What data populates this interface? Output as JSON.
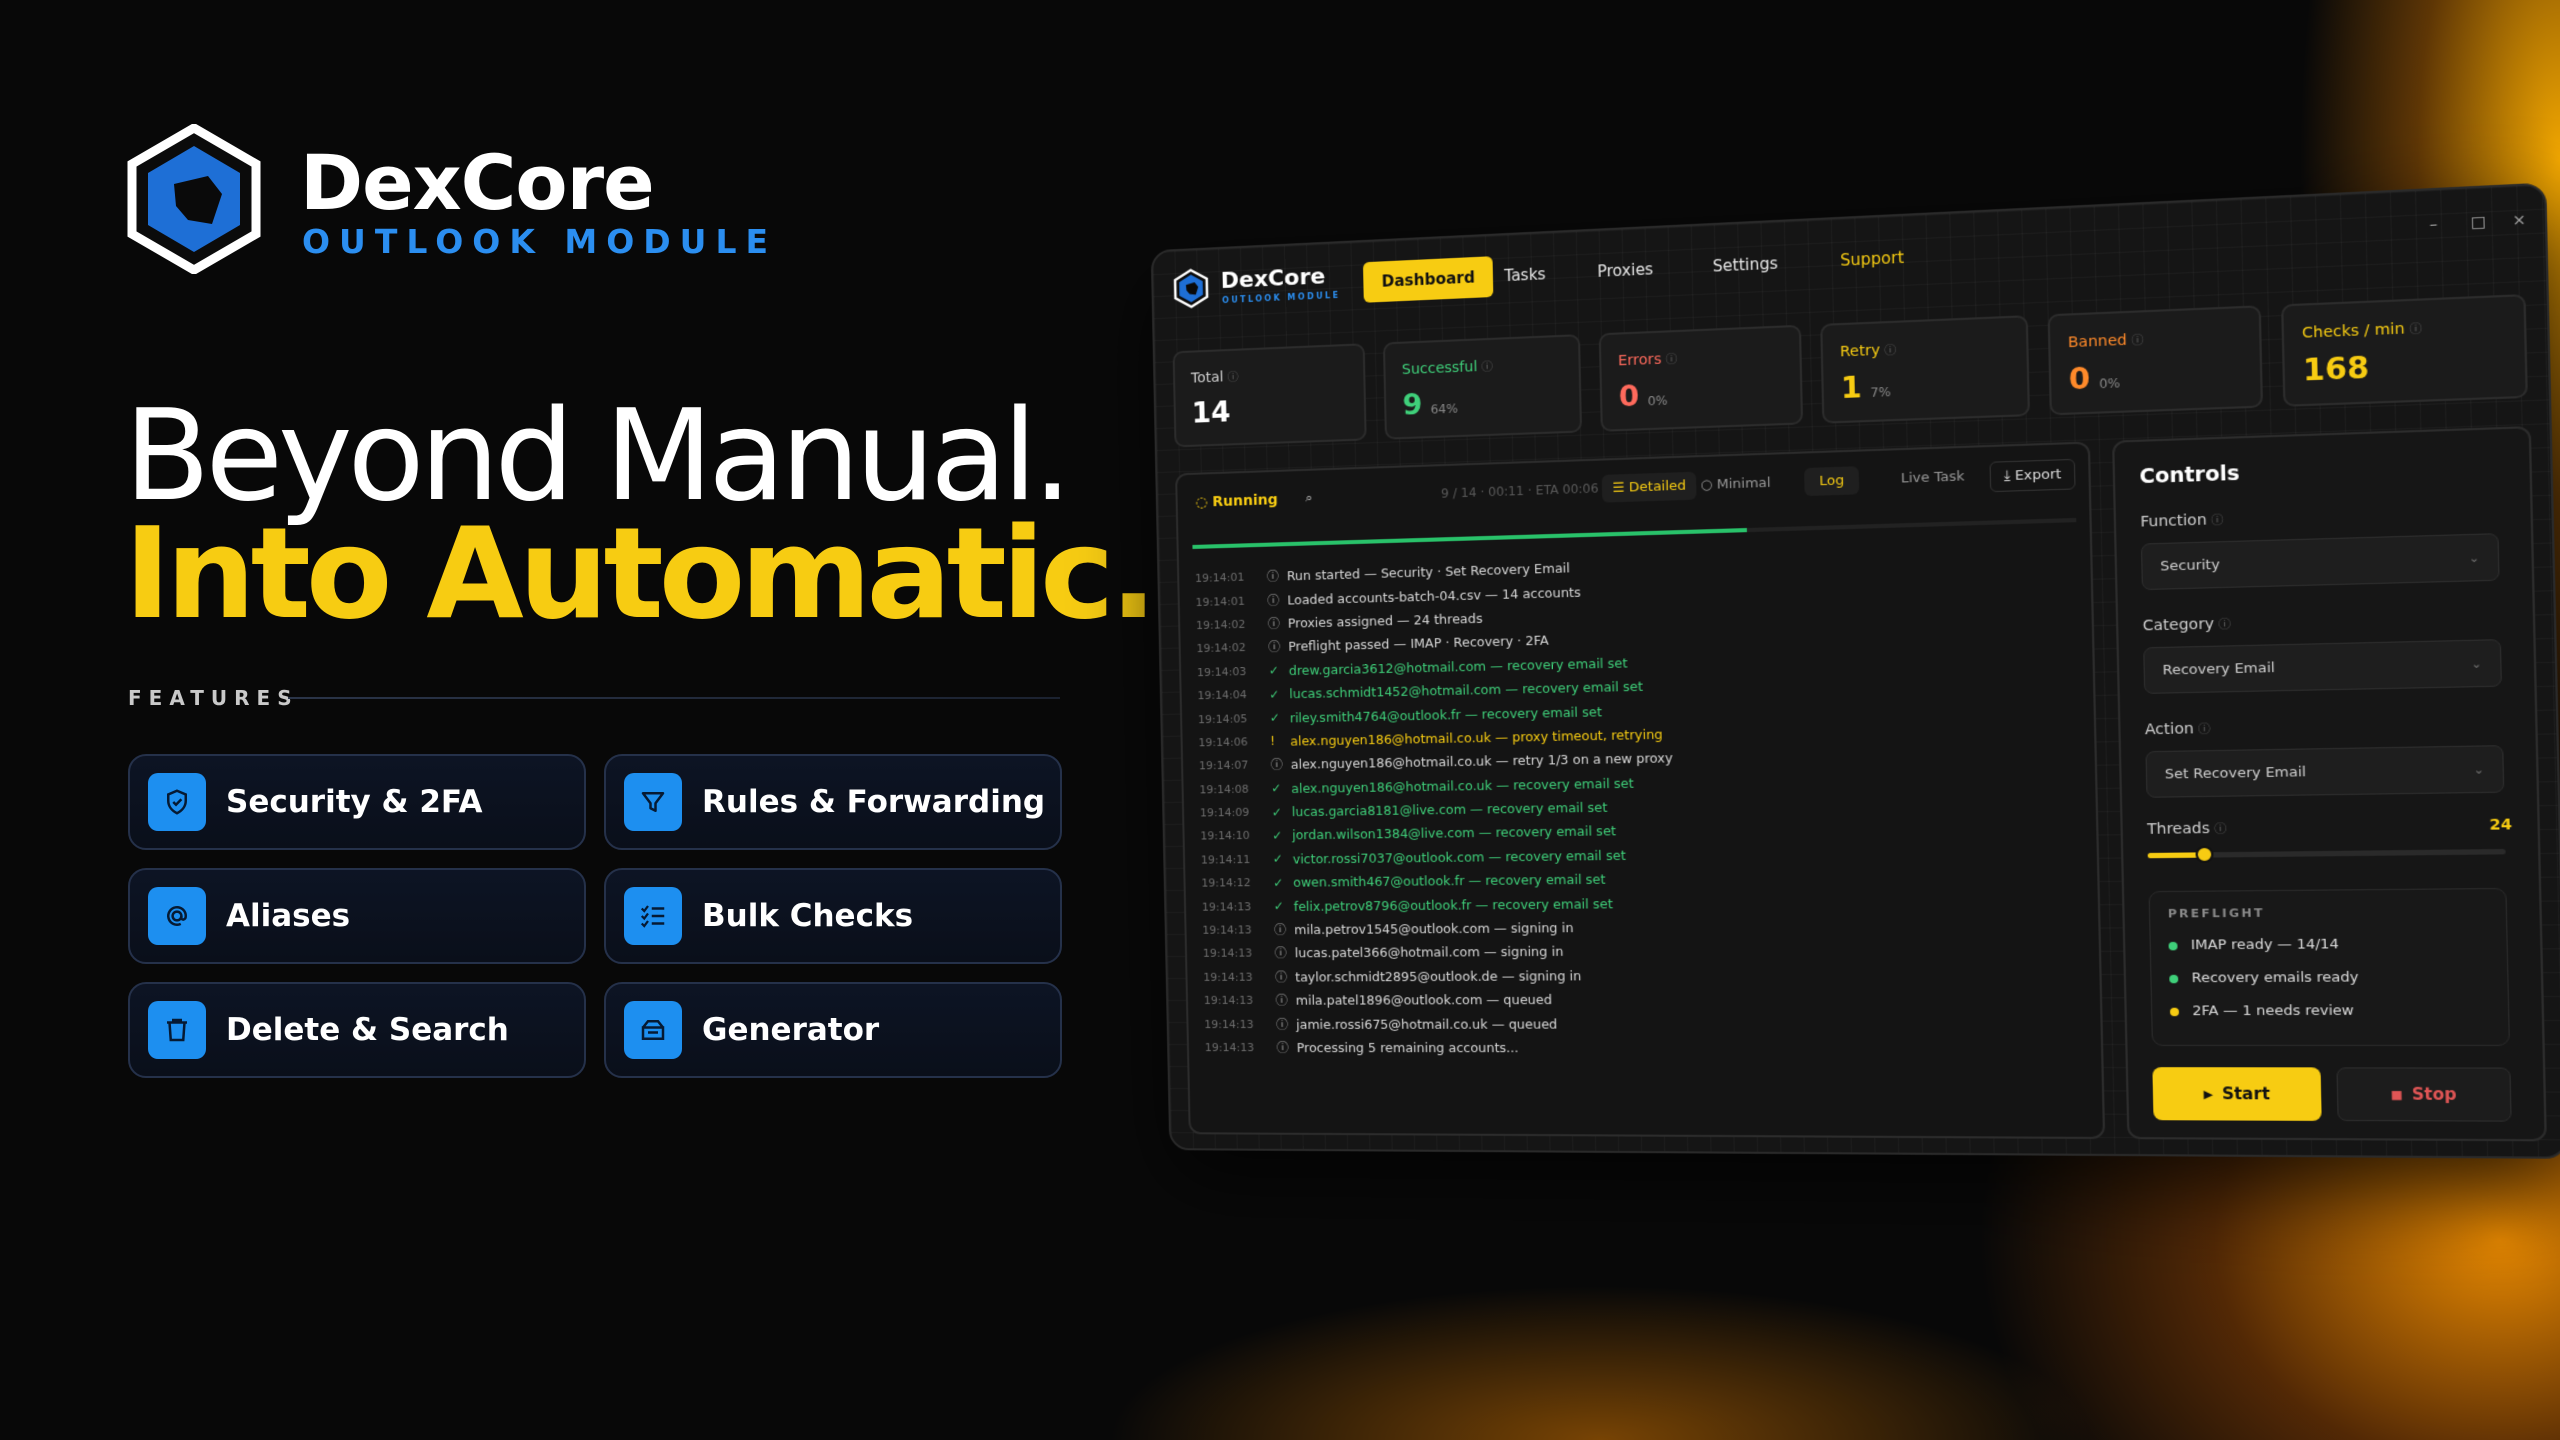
{
  "brand": {
    "name": "DexCore",
    "module": "OUTLOOK MODULE",
    "accent": "#2b8ef0",
    "highlight": "#f7cc12"
  },
  "hero": {
    "line1": "Beyond Manual.",
    "line2": "Into Automatic."
  },
  "features": {
    "label": "FEATURES",
    "items": [
      {
        "label": "Security & 2FA",
        "icon": "shield-icon"
      },
      {
        "label": "Rules & Forwarding",
        "icon": "filter-icon"
      },
      {
        "label": "Aliases",
        "icon": "at-icon"
      },
      {
        "label": "Bulk Checks",
        "icon": "checklist-icon"
      },
      {
        "label": "Delete & Search",
        "icon": "trash-icon"
      },
      {
        "label": "Generator",
        "icon": "inbox-icon"
      }
    ]
  },
  "app": {
    "title": "DexCore",
    "subtitle": "OUTLOOK MODULE",
    "nav": [
      "Dashboard",
      "Tasks",
      "Proxies",
      "Settings",
      "Support"
    ],
    "window_controls": [
      "–",
      "□",
      "×"
    ],
    "stats": [
      {
        "label": "Total",
        "value": "14",
        "pct": "",
        "color": "#ffffff"
      },
      {
        "label": "Successful",
        "value": "9",
        "pct": "64%",
        "color": "#3fd07a"
      },
      {
        "label": "Errors",
        "value": "0",
        "pct": "0%",
        "color": "#ff6a5c"
      },
      {
        "label": "Retry",
        "value": "1",
        "pct": "7%",
        "color": "#f7cc12"
      },
      {
        "label": "Banned",
        "value": "0",
        "pct": "0%",
        "color": "#ff8a2a"
      },
      {
        "label": "Checks / min",
        "value": "168",
        "pct": "",
        "color": "#f7cc12"
      }
    ],
    "toolbar": {
      "status": "Running",
      "progress_text": "9 / 14 · 00:11 · ETA 00:06",
      "progress": 0.64,
      "detailed": "Detailed",
      "minimal": "Minimal",
      "log": "Log",
      "live_task": "Live Task",
      "export": "Export"
    },
    "log": [
      {
        "t": "19:14:01",
        "msg": "Run started — Security · Set Recovery Email",
        "k": "info"
      },
      {
        "t": "19:14:01",
        "msg": "Loaded accounts-batch-04.csv — 14 accounts",
        "k": "info"
      },
      {
        "t": "19:14:02",
        "msg": "Proxies assigned — 24 threads",
        "k": "info"
      },
      {
        "t": "19:14:02",
        "msg": "Preflight passed — IMAP · Recovery · 2FA",
        "k": "info"
      },
      {
        "t": "19:14:03",
        "msg": "drew.garcia3612@hotmail.com — recovery email set",
        "k": "ok"
      },
      {
        "t": "19:14:04",
        "msg": "lucas.schmidt1452@hotmail.com — recovery email set",
        "k": "ok"
      },
      {
        "t": "19:14:05",
        "msg": "riley.smith4764@outlook.fr — recovery email set",
        "k": "ok"
      },
      {
        "t": "19:14:06",
        "msg": "alex.nguyen186@hotmail.co.uk — proxy timeout, retrying",
        "k": "warn"
      },
      {
        "t": "19:14:07",
        "msg": "alex.nguyen186@hotmail.co.uk — retry 1/3 on a new proxy",
        "k": "info"
      },
      {
        "t": "19:14:08",
        "msg": "alex.nguyen186@hotmail.co.uk — recovery email set",
        "k": "ok"
      },
      {
        "t": "19:14:09",
        "msg": "lucas.garcia8181@live.com — recovery email set",
        "k": "ok"
      },
      {
        "t": "19:14:10",
        "msg": "jordan.wilson1384@live.com — recovery email set",
        "k": "ok"
      },
      {
        "t": "19:14:11",
        "msg": "victor.rossi7037@outlook.com — recovery email set",
        "k": "ok"
      },
      {
        "t": "19:14:12",
        "msg": "owen.smith467@outlook.fr — recovery email set",
        "k": "ok"
      },
      {
        "t": "19:14:13",
        "msg": "felix.petrov8796@outlook.fr — recovery email set",
        "k": "ok"
      },
      {
        "t": "19:14:13",
        "msg": "mila.petrov1545@outlook.com — signing in",
        "k": "info"
      },
      {
        "t": "19:14:13",
        "msg": "lucas.patel366@hotmail.com — signing in",
        "k": "info"
      },
      {
        "t": "19:14:13",
        "msg": "taylor.schmidt2895@outlook.de — signing in",
        "k": "info"
      },
      {
        "t": "19:14:13",
        "msg": "mila.patel1896@outlook.com — queued",
        "k": "info"
      },
      {
        "t": "19:14:13",
        "msg": "jamie.rossi675@hotmail.co.uk — queued",
        "k": "info"
      },
      {
        "t": "19:14:13",
        "msg": "Processing 5 remaining accounts...",
        "k": "info"
      }
    ],
    "controls": {
      "title": "Controls",
      "function_label": "Function",
      "function_value": "Security",
      "category_label": "Category",
      "category_value": "Recovery Email",
      "action_label": "Action",
      "action_value": "Set Recovery Email",
      "threads_label": "Threads",
      "threads_value": "24",
      "threads_level": 0.16,
      "preflight_title": "PREFLIGHT",
      "preflight": [
        {
          "text": "IMAP ready — 14/14",
          "color": "#3fd07a"
        },
        {
          "text": "Recovery emails ready",
          "color": "#3fd07a"
        },
        {
          "text": "2FA — 1 needs review",
          "color": "#f7cc12"
        }
      ],
      "start": "Start",
      "stop": "Stop"
    }
  }
}
